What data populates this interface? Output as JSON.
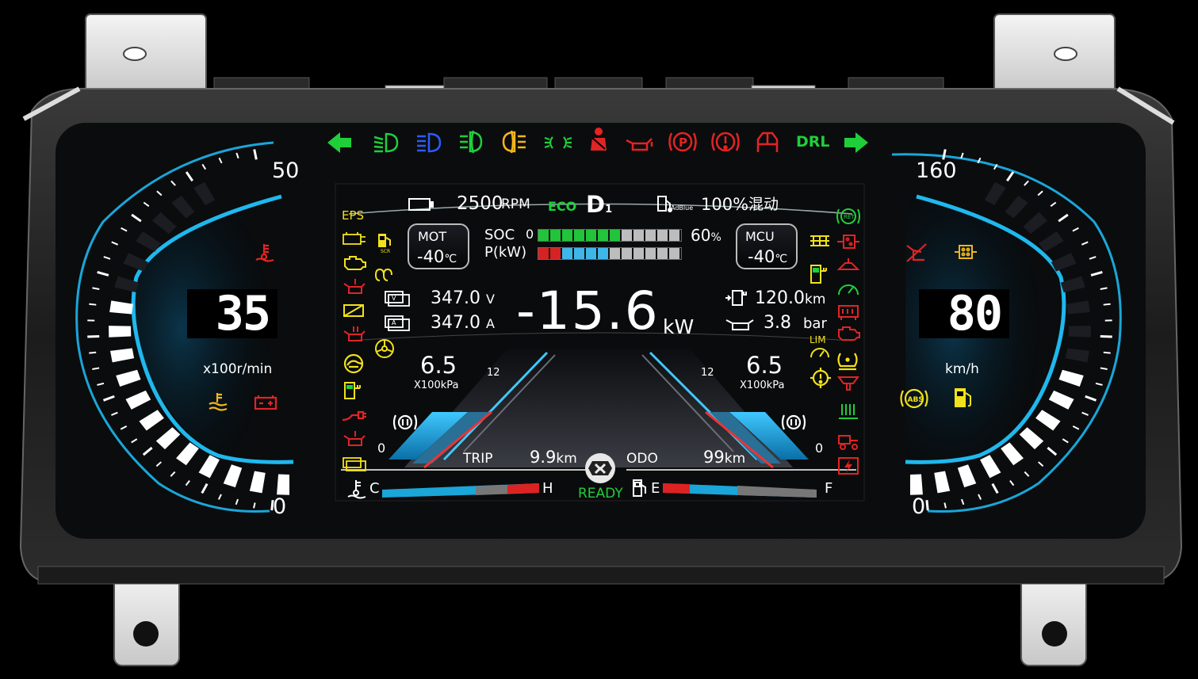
{
  "colors": {
    "accent": "#1aa6d8",
    "green": "#1fbf3a",
    "yellow": "#f2e21b",
    "red": "#e12424",
    "white": "#ffffff",
    "screen": "#0b0c0e"
  },
  "top_indicators": [
    "turn-left-arrow-icon",
    "low-beam-icon",
    "high-beam-icon",
    "front-fog-icon",
    "rear-fog-icon",
    "position-light-icon",
    "seatbelt-icon",
    "oil-pressure-icon",
    "parking-brake-icon",
    "brake-warning-icon",
    "door-open-icon",
    "turn-right-arrow-icon"
  ],
  "drl_label": "DRL",
  "tach": {
    "max_label": "50",
    "min_label": "0",
    "value": "35",
    "unit": "x100r/min",
    "fraction": 0.7
  },
  "speed": {
    "max_label": "160",
    "min_label": "0",
    "value": "80",
    "unit": "km/h",
    "fraction": 0.5
  },
  "center": {
    "rpm_value": "2500",
    "rpm_unit": "RPM",
    "eco_label": "ECO",
    "gear": "D",
    "gear_sub": "1",
    "adblue_label": "AdBlue",
    "adblue_value": "100%",
    "drive_mode": "混动",
    "mot_label": "MOT",
    "mot_temp": "-40",
    "temp_unit": "℃",
    "mcu_label": "MCU",
    "mcu_temp": "-40",
    "soc_label": "SOC",
    "soc_min": "0",
    "soc_value": "60",
    "soc_unit": "%",
    "soc_fraction": 0.6,
    "power_label": "P(kW)",
    "voltage_value": "347.0",
    "voltage_unit": "V",
    "current_value": "347.0",
    "current_unit": "A",
    "power_value": "-15.6",
    "power_unit": "kW",
    "range_value": "120.0",
    "range_unit": "km",
    "oil_value": "3.8",
    "oil_unit": "bar",
    "eps_label": "EPS",
    "scr_label": "SCR",
    "lim_label": "LIM",
    "left_pressure": {
      "value": "6.5",
      "unit": "X100kPa",
      "max": "12",
      "min": "0"
    },
    "right_pressure": {
      "value": "6.5",
      "unit": "X100kPa",
      "max": "12",
      "min": "0"
    },
    "trip_label": "TRIP",
    "trip_value": "9.9",
    "trip_unit": "km",
    "odo_label": "ODO",
    "odo_value": "99",
    "odo_unit": "km",
    "temp_gauge": {
      "low": "C",
      "high": "H"
    },
    "fuel_gauge": {
      "low": "E",
      "high": "F"
    },
    "ready_label": "READY"
  },
  "left_warnings": [
    "engine-fault-icon",
    "check-engine-icon",
    "oil-level-icon",
    "coolant-level-icon",
    "transmission-fault-icon",
    "eps-yellow-icon",
    "turtle-mode-icon",
    "charge-plug-icon",
    "motor-fault-icon",
    "charging-icon",
    "battery-fault-icon"
  ],
  "right_warnings": [
    "retarder-icon",
    "dpf-icon",
    "seat-warning-icon",
    "speed-limit-icon",
    "battery-heat-icon",
    "engine-red-icon",
    "tire-pressure-icon",
    "gear-fault-icon",
    "oil-filter-icon",
    "heater-icon",
    "trailer-icon",
    "high-voltage-icon"
  ]
}
